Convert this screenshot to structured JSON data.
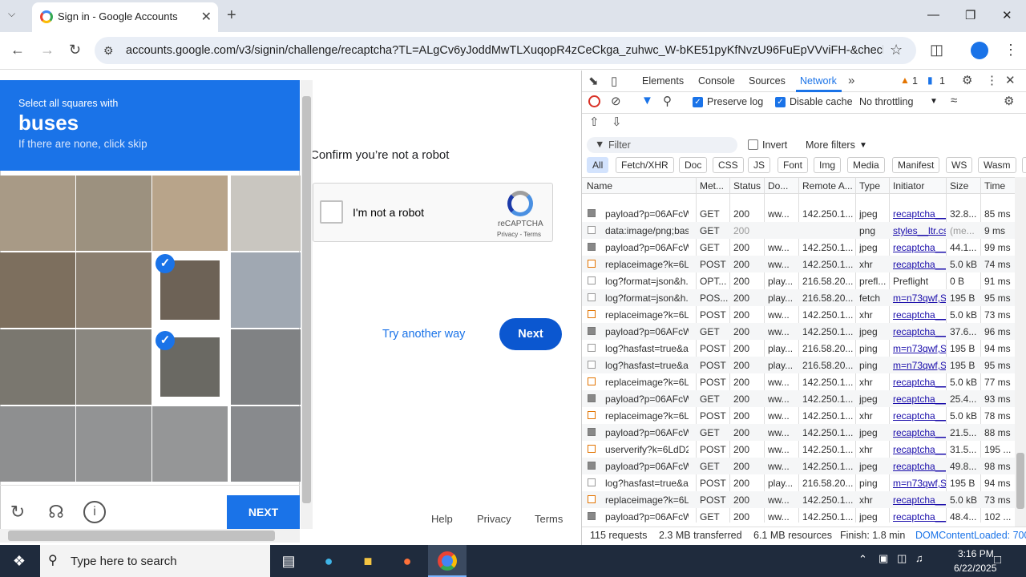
{
  "browser": {
    "tab_title": "Sign in - Google Accounts",
    "url": "accounts.google.com/v3/signin/challenge/recaptcha?TL=ALgCv6yJoddMwTLXuqopR4zCeCkga_zuhwc_W-bKE51pyKfNvzU96FuEpVVviFH-&checkConn..."
  },
  "captcha": {
    "instruction": "Select all squares with",
    "target": "buses",
    "skip_hint": "If there are none, click skip",
    "next_label": "NEXT",
    "selected_tiles": [
      6,
      10
    ]
  },
  "signin": {
    "heading": "Confirm you’re not a robot",
    "checkbox_label": "I'm not a robot",
    "brand": "reCAPTCHA",
    "privacy_terms": "Privacy - Terms",
    "try_another": "Try another way",
    "next": "Next",
    "footer": [
      "Help",
      "Privacy",
      "Terms"
    ]
  },
  "devtools": {
    "tabs": [
      "Elements",
      "Console",
      "Sources",
      "Network"
    ],
    "warnings": "1",
    "messages": "1",
    "preserve_log": "Preserve log",
    "disable_cache": "Disable cache",
    "throttling": "No throttling",
    "filter_placeholder": "Filter",
    "invert": "Invert",
    "more_filters": "More filters",
    "chips": [
      "All",
      "Fetch/XHR",
      "Doc",
      "CSS",
      "JS",
      "Font",
      "Img",
      "Media",
      "Manifest",
      "WS",
      "Wasm",
      "Other"
    ],
    "columns": [
      "Name",
      "Met...",
      "Status",
      "Do...",
      "Remote A...",
      "Type",
      "Initiator",
      "Size",
      "Time"
    ],
    "rows": [
      [
        "payload?p=06AFcW...",
        "GET",
        "200",
        "ww...",
        "142.250.1...",
        "jpeg",
        "recaptcha__e",
        "32.8...",
        "85 ms"
      ],
      [
        "data:image/png;bas...",
        "GET",
        "200",
        "",
        "",
        "png",
        "styles__ltr.css",
        "(me...",
        "9 ms"
      ],
      [
        "payload?p=06AFcW...",
        "GET",
        "200",
        "ww...",
        "142.250.1...",
        "jpeg",
        "recaptcha__e",
        "44.1...",
        "99 ms"
      ],
      [
        "replaceimage?k=6L...",
        "POST",
        "200",
        "ww...",
        "142.250.1...",
        "xhr",
        "recaptcha__e",
        "5.0 kB",
        "74 ms"
      ],
      [
        "log?format=json&h...",
        "OPT...",
        "200",
        "play...",
        "216.58.20...",
        "prefl...",
        "Preflight",
        "0 B",
        "91 ms"
      ],
      [
        "log?format=json&h...",
        "POS...",
        "200",
        "play...",
        "216.58.20...",
        "fetch",
        "m=n73qwf,S",
        "195 B",
        "95 ms"
      ],
      [
        "replaceimage?k=6L...",
        "POST",
        "200",
        "ww...",
        "142.250.1...",
        "xhr",
        "recaptcha__e",
        "5.0 kB",
        "73 ms"
      ],
      [
        "payload?p=06AFcW...",
        "GET",
        "200",
        "ww...",
        "142.250.1...",
        "jpeg",
        "recaptcha__e",
        "37.6...",
        "96 ms"
      ],
      [
        "log?hasfast=true&a...",
        "POST",
        "200",
        "play...",
        "216.58.20...",
        "ping",
        "m=n73qwf,S",
        "195 B",
        "94 ms"
      ],
      [
        "log?hasfast=true&a...",
        "POST",
        "200",
        "play...",
        "216.58.20...",
        "ping",
        "m=n73qwf,S",
        "195 B",
        "95 ms"
      ],
      [
        "replaceimage?k=6L...",
        "POST",
        "200",
        "ww...",
        "142.250.1...",
        "xhr",
        "recaptcha__e",
        "5.0 kB",
        "77 ms"
      ],
      [
        "payload?p=06AFcW...",
        "GET",
        "200",
        "ww...",
        "142.250.1...",
        "jpeg",
        "recaptcha__e",
        "25.4...",
        "93 ms"
      ],
      [
        "replaceimage?k=6L...",
        "POST",
        "200",
        "ww...",
        "142.250.1...",
        "xhr",
        "recaptcha__e",
        "5.0 kB",
        "78 ms"
      ],
      [
        "payload?p=06AFcW...",
        "GET",
        "200",
        "ww...",
        "142.250.1...",
        "jpeg",
        "recaptcha__e",
        "21.5...",
        "88 ms"
      ],
      [
        "userverify?k=6LdD2...",
        "POST",
        "200",
        "ww...",
        "142.250.1...",
        "xhr",
        "recaptcha__e",
        "31.5...",
        "195 ..."
      ],
      [
        "payload?p=06AFcW...",
        "GET",
        "200",
        "ww...",
        "142.250.1...",
        "jpeg",
        "recaptcha__e",
        "49.8...",
        "98 ms"
      ],
      [
        "log?hasfast=true&a...",
        "POST",
        "200",
        "play...",
        "216.58.20...",
        "ping",
        "m=n73qwf,S",
        "195 B",
        "94 ms"
      ],
      [
        "replaceimage?k=6L...",
        "POST",
        "200",
        "ww...",
        "142.250.1...",
        "xhr",
        "recaptcha__e",
        "5.0 kB",
        "73 ms"
      ],
      [
        "payload?p=06AFcW...",
        "GET",
        "200",
        "ww...",
        "142.250.1...",
        "jpeg",
        "recaptcha__e",
        "48.4...",
        "102 ..."
      ]
    ],
    "status": {
      "requests": "115 requests",
      "transferred": "2.3 MB transferred",
      "resources": "6.1 MB resources",
      "finish": "Finish: 1.8 min",
      "dcl": "DOMContentLoaded: 700"
    }
  },
  "taskbar": {
    "search": "Type here to search",
    "time": "3:16 PM",
    "date": "6/22/2025"
  }
}
